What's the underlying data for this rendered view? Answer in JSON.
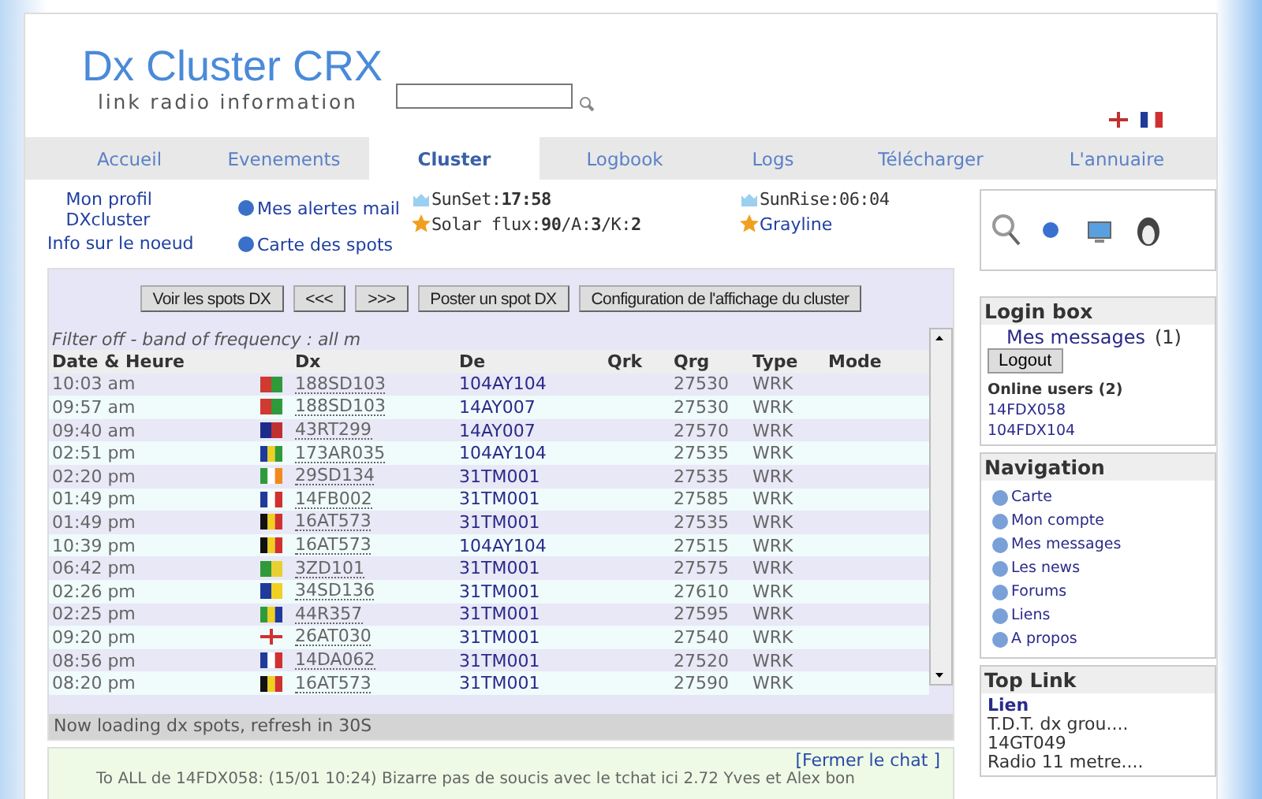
{
  "header": {
    "title": "Dx Cluster CRX",
    "subtitle": "link radio information"
  },
  "nav": [
    {
      "label": "Accueil",
      "selected": false
    },
    {
      "label": "Evenements",
      "selected": false
    },
    {
      "label": "Cluster",
      "selected": true
    },
    {
      "label": "Logbook",
      "selected": false
    },
    {
      "label": "Logs",
      "selected": false
    },
    {
      "label": "Télécharger",
      "selected": false
    },
    {
      "label": "L'annuaire",
      "selected": false
    }
  ],
  "quick_links": {
    "col1": [
      "Mon profil DXcluster",
      "Info sur le noeud"
    ],
    "col2": [
      "Mes alertes mail",
      "Carte des spots"
    ]
  },
  "solar": {
    "sunset_label": "SunSet:",
    "sunset": "17:58",
    "sunrise": "SunRise:06:04",
    "flux": "Solar flux:**90**/A:**3**/K:**2**",
    "grayline": "Grayline"
  },
  "cluster": {
    "buttons": [
      "Voir les spots DX",
      "<<<",
      ">>>",
      "Poster un spot DX",
      "Configuration de l'affichage du cluster"
    ],
    "filter": "Filter off - band of frequency : all m",
    "columns": [
      "Date & Heure",
      "Dx",
      "De",
      "Qrk",
      "Qrg",
      "Type",
      "Mode"
    ],
    "rows": [
      {
        "time": "10:03 am",
        "kind": "belarus",
        "dx": "188SD103",
        "de": "104AY104",
        "qrg": "27530",
        "type": "WRK"
      },
      {
        "time": "09:57 am",
        "kind": "belarus",
        "dx": "188SD103",
        "de": "14AY007",
        "qrg": "27530",
        "type": "WRK"
      },
      {
        "time": "09:40 am",
        "kind": "australia",
        "dx": "43RT299",
        "de": "14AY007",
        "qrg": "27570",
        "type": "WRK"
      },
      {
        "time": "02:51 pm",
        "kind": "stvincent",
        "dx": "173AR035",
        "de": "104AY104",
        "qrg": "27535",
        "type": "WRK"
      },
      {
        "time": "02:20 pm",
        "kind": "ireland",
        "dx": "29SD134",
        "de": "31TM001",
        "qrg": "27535",
        "type": "WRK"
      },
      {
        "time": "01:49 pm",
        "kind": "france",
        "dx": "14FB002",
        "de": "31TM001",
        "qrg": "27585",
        "type": "WRK"
      },
      {
        "time": "01:49 pm",
        "kind": "belgium",
        "dx": "16AT573",
        "de": "31TM001",
        "qrg": "27535",
        "type": "WRK"
      },
      {
        "time": "10:39 pm",
        "kind": "belgium",
        "dx": "16AT573",
        "de": "104AY104",
        "qrg": "27515",
        "type": "WRK"
      },
      {
        "time": "06:42 pm",
        "kind": "brazil",
        "dx": "3ZD101",
        "de": "31TM001",
        "qrg": "27575",
        "type": "WRK"
      },
      {
        "time": "02:26 pm",
        "kind": "barbados",
        "dx": "34SD136",
        "de": "31TM001",
        "qrg": "27610",
        "type": "WRK"
      },
      {
        "time": "02:25 pm",
        "kind": "southafrica",
        "dx": "44R357",
        "de": "31TM001",
        "qrg": "27595",
        "type": "WRK"
      },
      {
        "time": "09:20 pm",
        "kind": "england",
        "dx": "26AT030",
        "de": "31TM001",
        "qrg": "27540",
        "type": "WRK"
      },
      {
        "time": "08:56 pm",
        "kind": "france",
        "dx": "14DA062",
        "de": "31TM001",
        "qrg": "27520",
        "type": "WRK"
      },
      {
        "time": "08:20 pm",
        "kind": "belgium",
        "dx": "16AT573",
        "de": "31TM001",
        "qrg": "27590",
        "type": "WRK"
      }
    ],
    "status": "Now loading dx spots, refresh in 30S"
  },
  "chat": {
    "close": "[Fermer le chat ]",
    "line": "To ALL de 14FDX058: (15/01 10:24) Bizarre pas de soucis avec le tchat ici 2.72 Yves et Alex bon"
  },
  "login_box": {
    "title": "Login box",
    "messages": "Mes messages",
    "count": "(1)",
    "logout": "Logout",
    "online_title": "Online users (2)",
    "users": [
      "14FDX058",
      "104FDX104"
    ]
  },
  "navigation": {
    "title": "Navigation",
    "items": [
      "Carte",
      "Mon compte",
      "Mes messages",
      "Les news",
      "Forums",
      "Liens",
      "A propos"
    ]
  },
  "top_link": {
    "title": "Top Link",
    "heading": "Lien",
    "items": [
      "T.D.T. dx grou....",
      "14GT049",
      "Radio 11 metre...."
    ]
  }
}
